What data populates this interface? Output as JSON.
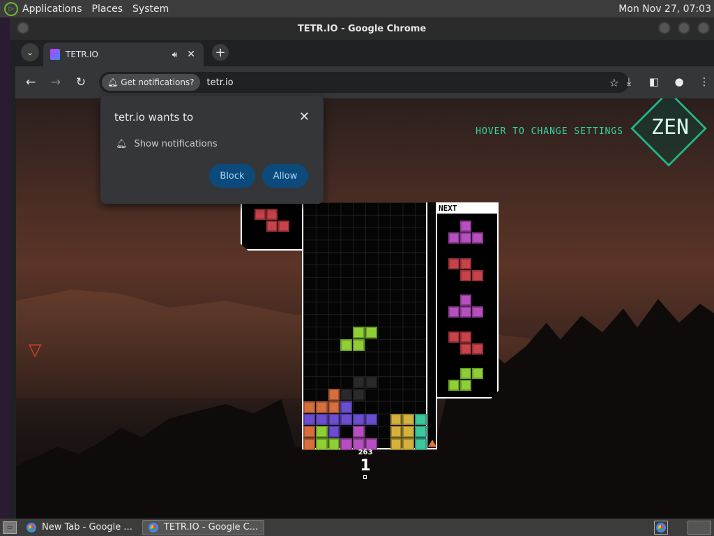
{
  "top_panel": {
    "menus": [
      "Applications",
      "Places",
      "System"
    ],
    "clock": "Mon Nov 27, 07:03"
  },
  "window": {
    "title": "TETR.IO - Google Chrome"
  },
  "tab": {
    "title": "TETR.IO"
  },
  "toolbar": {
    "notification_chip": "Get notifications?",
    "url": "tetr.io"
  },
  "permission_popup": {
    "title": "tetr.io wants to",
    "permission": "Show notifications",
    "block_label": "Block",
    "allow_label": "Allow"
  },
  "game": {
    "hover_text": "HOVER TO CHANGE SETTINGS",
    "mode": "ZEN",
    "next_label": "NEXT",
    "score_small": "263",
    "score_big": "1"
  },
  "taskbar": {
    "tasks": [
      "New Tab - Google ...",
      "TETR.IO - Google C..."
    ]
  },
  "colors": {
    "T": "#b84fc0",
    "Z": "#c8424a",
    "S": "#8fcf36",
    "L": "#d66e3e",
    "J": "#6b4ed0",
    "O": "#d4b13c",
    "I": "#3cc8a0",
    "garbage": "#2a2a2a",
    "zen_green": "#33d6a6"
  }
}
